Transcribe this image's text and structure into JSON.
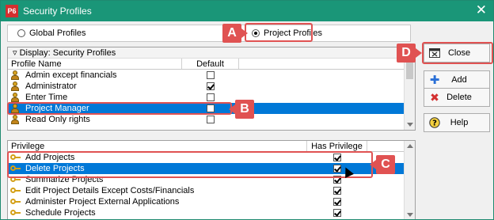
{
  "window": {
    "title": "Security Profiles",
    "app_badge": "P6",
    "close_glyph": "✕"
  },
  "radio": {
    "global_label": "Global Profiles",
    "project_label": "Project Profiles",
    "selected": "project"
  },
  "callouts": {
    "a": "A",
    "b": "B",
    "c": "C",
    "d": "D"
  },
  "top_panel": {
    "display_label": "Display: Security Profiles",
    "headers": {
      "name": "Profile Name",
      "default": "Default"
    },
    "rows": [
      {
        "name": "Admin except financials",
        "default": false,
        "selected": false
      },
      {
        "name": "Administrator",
        "default": true,
        "selected": false
      },
      {
        "name": "Enter Time",
        "default": false,
        "selected": false
      },
      {
        "name": "Project Manager",
        "default": false,
        "selected": true
      },
      {
        "name": "Read Only rights",
        "default": false,
        "selected": false
      }
    ]
  },
  "bottom_panel": {
    "headers": {
      "privilege": "Privilege",
      "has": "Has Privilege"
    },
    "rows": [
      {
        "name": "Add Projects",
        "has": true,
        "selected": false
      },
      {
        "name": "Delete Projects",
        "has": true,
        "selected": true
      },
      {
        "name": "Summarize Projects",
        "has": true,
        "selected": false
      },
      {
        "name": "Edit Project Details Except Costs/Financials",
        "has": true,
        "selected": false
      },
      {
        "name": "Administer Project External Applications",
        "has": true,
        "selected": false
      },
      {
        "name": "Schedule Projects",
        "has": true,
        "selected": false
      }
    ]
  },
  "buttons": {
    "close": "Close",
    "add": "Add",
    "delete": "Delete",
    "help": "Help"
  },
  "colors": {
    "titlebar": "#1a9678",
    "selection": "#0078d7",
    "callout": "#e05252"
  }
}
